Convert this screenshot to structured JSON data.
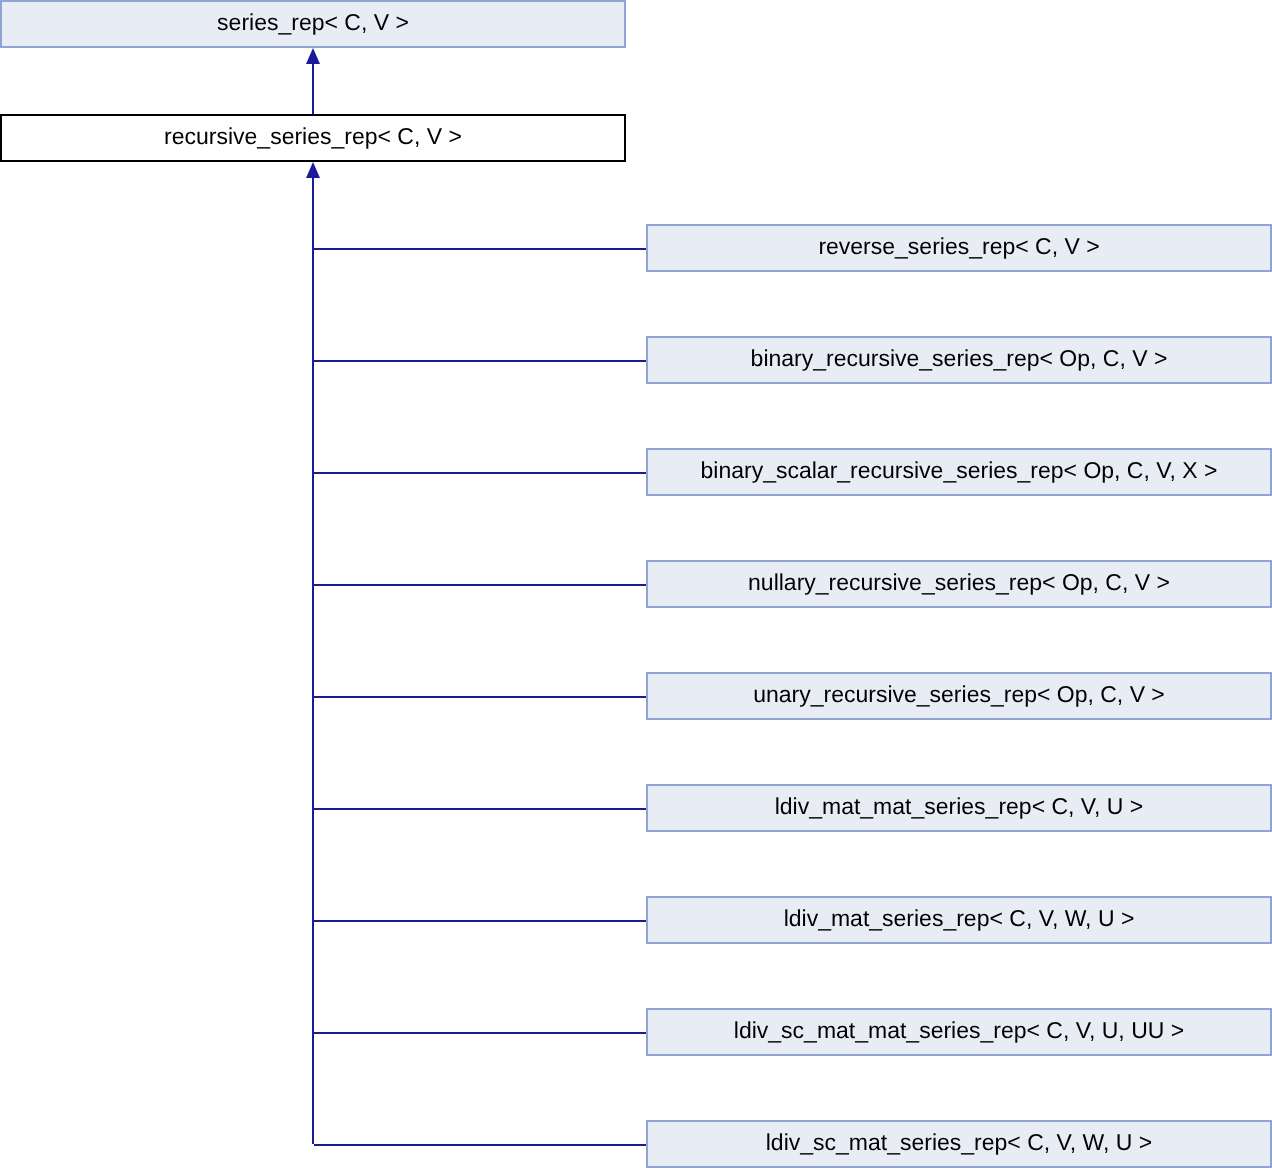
{
  "base": {
    "label": "series_rep< C, V >"
  },
  "current": {
    "label": "recursive_series_rep< C, V >"
  },
  "derived": [
    {
      "label": "reverse_series_rep< C, V >"
    },
    {
      "label": "binary_recursive_series_rep< Op, C, V >"
    },
    {
      "label": "binary_scalar_recursive_series_rep< Op, C, V, X >"
    },
    {
      "label": "nullary_recursive_series_rep< Op, C, V >"
    },
    {
      "label": "unary_recursive_series_rep< Op, C, V >"
    },
    {
      "label": "ldiv_mat_mat_series_rep< C, V, U >"
    },
    {
      "label": "ldiv_mat_series_rep< C, V, W, U >"
    },
    {
      "label": "ldiv_sc_mat_mat_series_rep< C, V, U, UU >"
    },
    {
      "label": "ldiv_sc_mat_series_rep< C, V, W, U >"
    }
  ]
}
